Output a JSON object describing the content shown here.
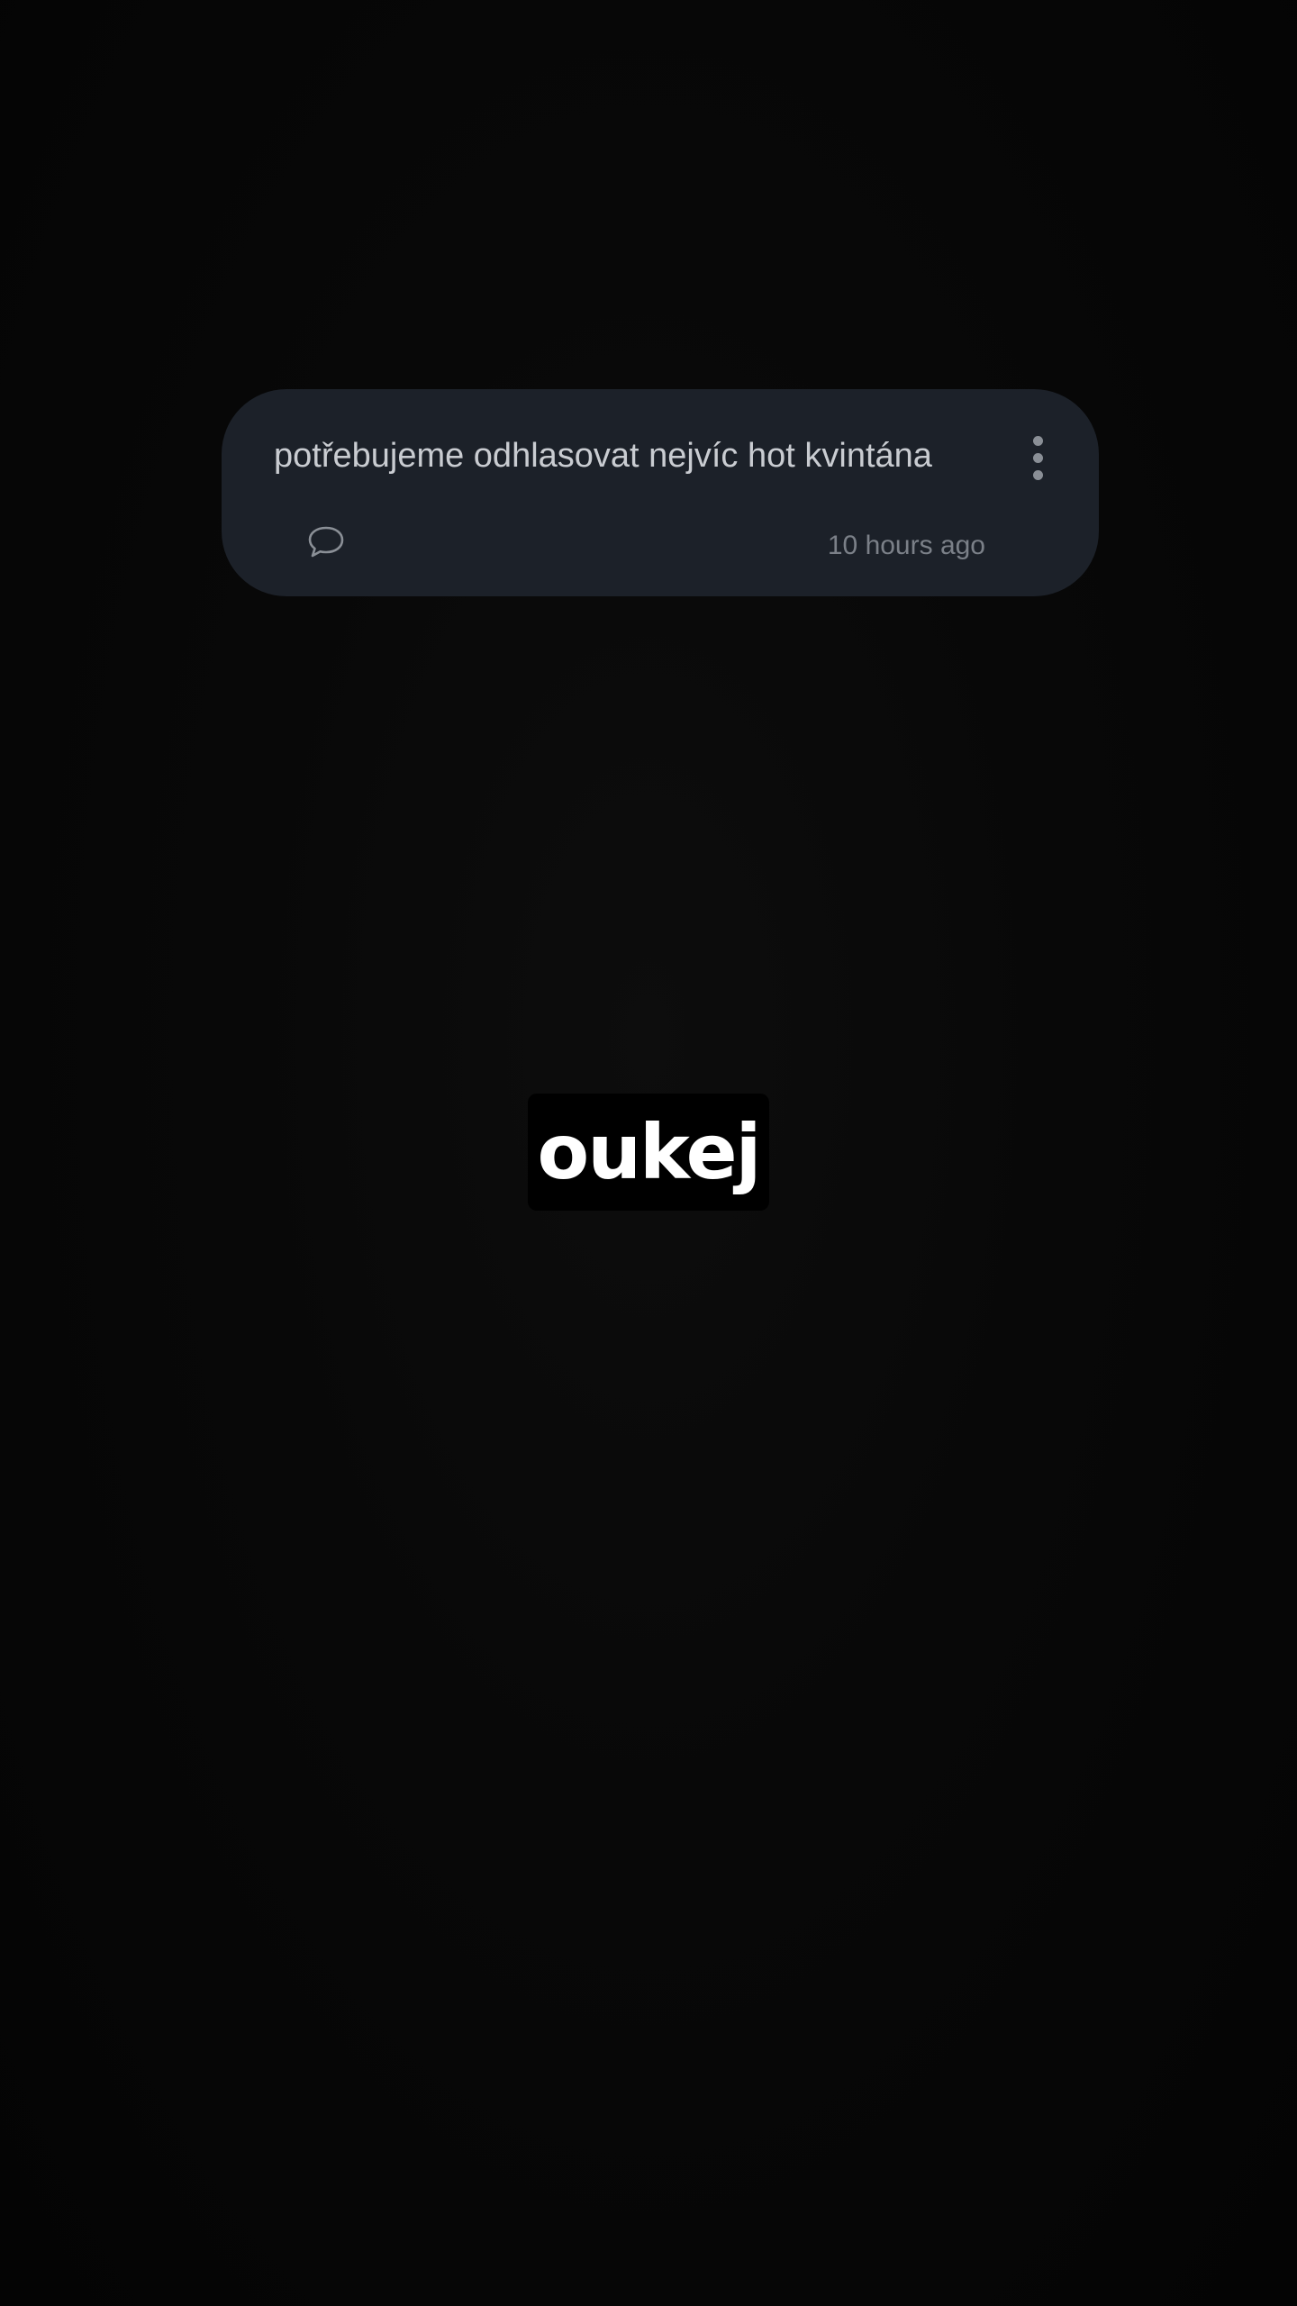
{
  "post": {
    "text": "potřebujeme odhlasovat nejvíc hot kvintána",
    "time": "10 hours ago",
    "comment_icon": "speech-bubble-outline",
    "more_icon": "vertical-ellipsis",
    "card_color": "#1c2129",
    "text_color": "#c9ccd1",
    "time_color": "#7b8088"
  },
  "caption": {
    "text": "oukej",
    "text_color": "#ffffff",
    "background_color": "#000000"
  },
  "background_color": "#060606"
}
